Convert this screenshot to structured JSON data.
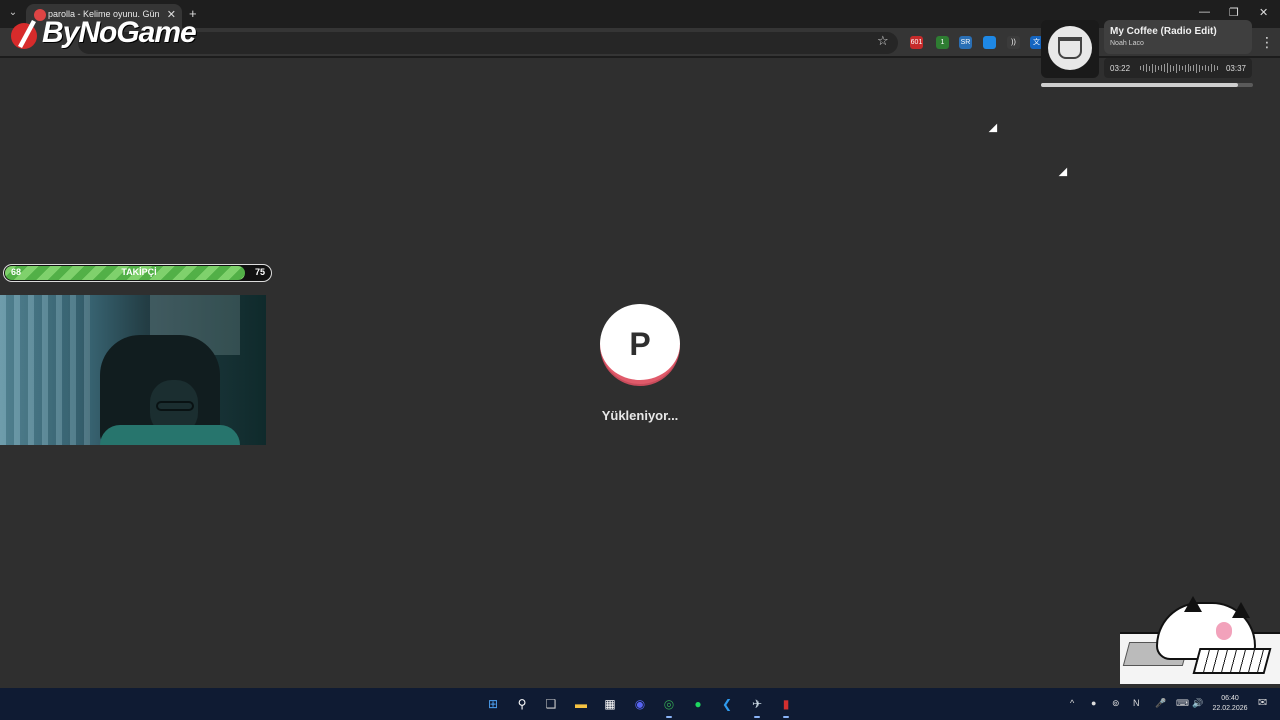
{
  "browser": {
    "tab_title": "parolla - Kelime oyunu. Günlük",
    "tab_close": "✕",
    "new_tab": "+",
    "tab_menu": "⌄",
    "window_controls": [
      "—",
      "❐",
      "✕"
    ],
    "star": "☆",
    "menu": "⋮",
    "extensions": [
      {
        "name": "ext-red-badge",
        "text": "601",
        "color": "#c62b2b"
      },
      {
        "name": "ext-green",
        "text": "1",
        "color": "#2e7d32"
      },
      {
        "name": "ext-sub",
        "text": "SR",
        "color": "#2a6fb5"
      },
      {
        "name": "ext-blue",
        "text": "",
        "color": "#1e88e5"
      },
      {
        "name": "ext-audio",
        "text": "))",
        "color": "#3b3b3b"
      },
      {
        "name": "ext-translate",
        "text": "文",
        "color": "#1565c0"
      }
    ]
  },
  "logo": {
    "text": "ByNoGame",
    "brand_color": "#d72b2b"
  },
  "music": {
    "title": "My Coffee (Radio Edit)",
    "artist": "Noah Laco",
    "current_time": "03:22",
    "total_time": "03:37",
    "progress": 0.93
  },
  "follow_goal": {
    "current": "68",
    "label": "TAKİPÇİ",
    "goal": "75",
    "fill_fraction": 0.9
  },
  "loading": {
    "letter": "P",
    "text": "Yükleniyor...",
    "accent": "#e05a6a"
  },
  "taskbar": {
    "apps": [
      {
        "name": "start-icon",
        "glyph": "⊞",
        "color": "#4ea1f3"
      },
      {
        "name": "search-icon",
        "glyph": "⚲",
        "color": "#ffffff"
      },
      {
        "name": "task-view-icon",
        "glyph": "❑",
        "color": "#cfcfcf"
      },
      {
        "name": "file-explorer-icon",
        "glyph": "▬",
        "color": "#f6c342"
      },
      {
        "name": "store-icon",
        "glyph": "▦",
        "color": "#ffffff"
      },
      {
        "name": "discord-icon",
        "glyph": "◉",
        "color": "#5865f2"
      },
      {
        "name": "chrome-icon",
        "glyph": "◎",
        "color": "#34a853"
      },
      {
        "name": "spotify-icon",
        "glyph": "●",
        "color": "#1ed760"
      },
      {
        "name": "vscode-icon",
        "glyph": "❮",
        "color": "#2f9bef"
      },
      {
        "name": "steam-icon",
        "glyph": "✈",
        "color": "#c7d5e0"
      },
      {
        "name": "red-app-icon",
        "glyph": "▮",
        "color": "#d32f2f"
      }
    ],
    "tray": [
      "^",
      "●",
      "⊚",
      "N",
      "🎤",
      "⌨",
      "🔊"
    ],
    "time": "06:40",
    "date": "22.02.2026"
  }
}
